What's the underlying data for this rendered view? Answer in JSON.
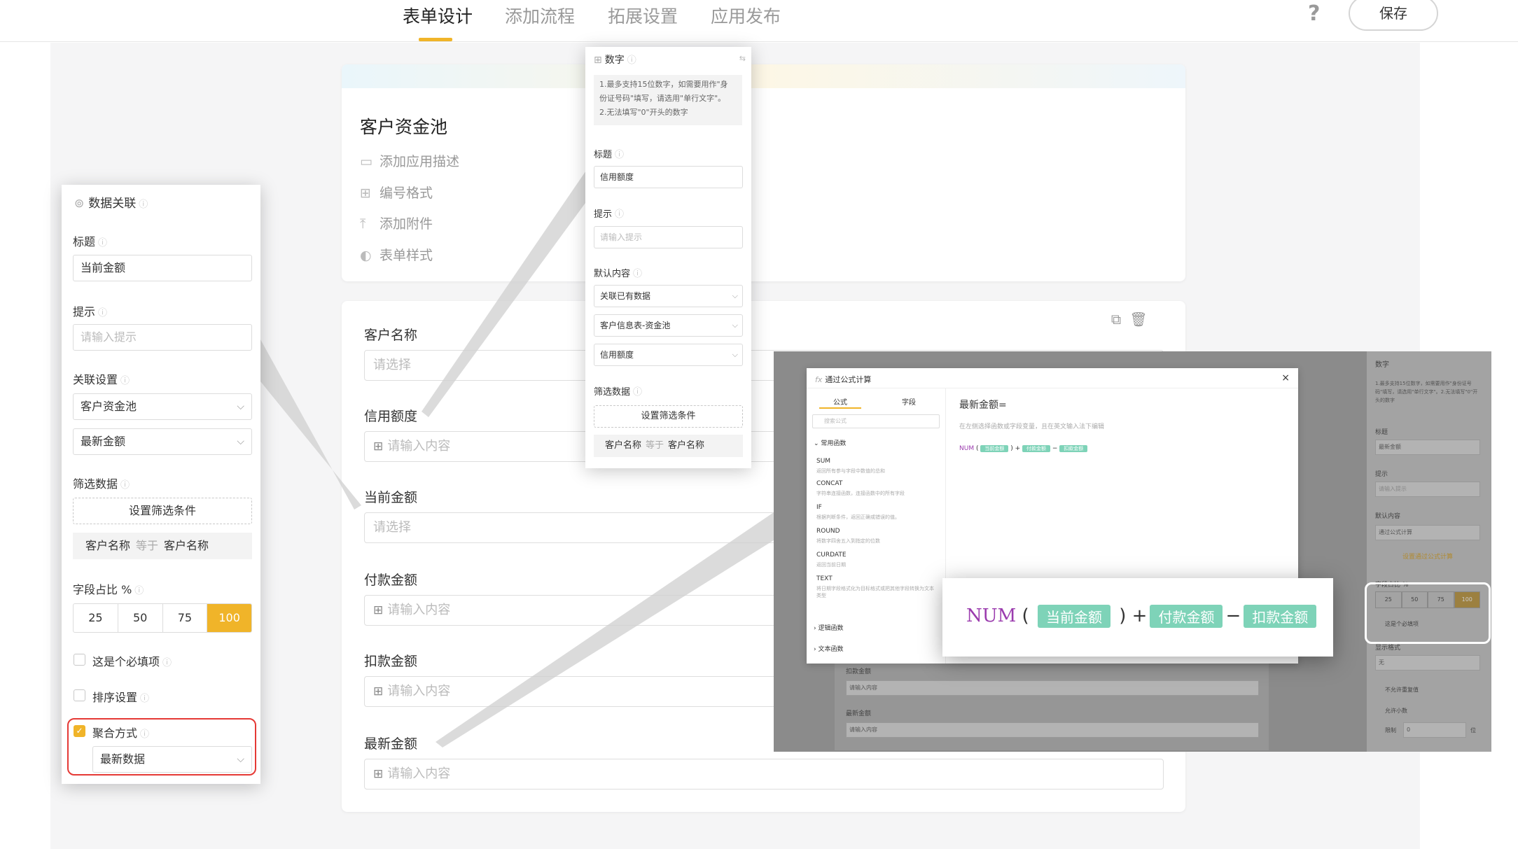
{
  "nav": {
    "tabs": [
      "表单设计",
      "添加流程",
      "拓展设置",
      "应用发布"
    ],
    "active_tab": "表单设计",
    "help": "?",
    "save": "保存"
  },
  "form": {
    "title": "客户资金池",
    "meta": [
      {
        "icon": "comment-icon",
        "label": "添加应用描述"
      },
      {
        "icon": "number-format-icon",
        "label": "编号格式"
      },
      {
        "icon": "upload-icon",
        "label": "添加附件"
      },
      {
        "icon": "palette-icon",
        "label": "表单样式"
      }
    ],
    "fields": [
      {
        "label": "客户名称",
        "placeholder": "请选择",
        "icon": ""
      },
      {
        "label": "信用额度",
        "placeholder": "请输入内容",
        "icon": "number-icon"
      },
      {
        "label": "当前金额",
        "placeholder": "请选择",
        "icon": ""
      },
      {
        "label": "付款金额",
        "placeholder": "请输入内容",
        "icon": "number-icon"
      },
      {
        "label": "扣款金额",
        "placeholder": "请输入内容",
        "icon": "number-icon"
      },
      {
        "label": "最新金额",
        "placeholder": "请输入内容",
        "icon": "number-icon"
      }
    ]
  },
  "left_panel": {
    "title": "数据关联",
    "title_label": "标题",
    "title_value": "当前金额",
    "hint_label": "提示",
    "hint_placeholder": "请输入提示",
    "link_label": "关联设置",
    "link_select1": "客户资金池",
    "link_select2": "最新金额",
    "filter_label": "筛选数据",
    "filter_button": "设置筛选条件",
    "filter_left": "客户名称",
    "filter_op": "等于",
    "filter_right": "客户名称",
    "width_label": "字段占比 %",
    "width_options": [
      "25",
      "50",
      "75",
      "100"
    ],
    "width_selected": "100",
    "required_label": "这是个必填项",
    "sort_label": "排序设置",
    "agg_label": "聚合方式",
    "agg_value": "最新数据"
  },
  "center_panel": {
    "title": "数字",
    "note_lines": [
      "1.最多支持15位数字，如需要用作\"身",
      "份证号码\"填写，请选用\"单行文字\"。",
      "2.无法填写\"0\"开头的数字"
    ],
    "title_label": "标题",
    "title_value": "信用额度",
    "hint_label": "提示",
    "hint_placeholder": "请输入提示",
    "default_label": "默认内容",
    "default_select1": "关联已有数据",
    "default_select2": "客户信息表-资金池",
    "default_select3": "信用额度",
    "filter_label": "筛选数据",
    "filter_button": "设置筛选条件",
    "filter_left": "客户名称",
    "filter_op": "等于",
    "filter_right": "客户名称"
  },
  "formula_modal": {
    "title": "通过公式计算",
    "tab_formula": "公式",
    "tab_field": "字段",
    "search_placeholder": "搜索公式",
    "group_common": "常用函数",
    "functions": [
      {
        "name": "SUM",
        "desc": "返回所有参与字段中数值的总和"
      },
      {
        "name": "CONCAT",
        "desc": "字符串连接函数，连接函数中的所有字段"
      },
      {
        "name": "IF",
        "desc": "根据判断条件，返回正确或错误的值。"
      },
      {
        "name": "ROUND",
        "desc": "将数字四舍五入到指定的位数"
      },
      {
        "name": "CURDATE",
        "desc": "返回当前日期"
      },
      {
        "name": "TEXT",
        "desc": "将日期字段格式化为目标格式或把其他字段转换为文本类型"
      }
    ],
    "group_logic": "逻辑函数",
    "group_text": "文本函数",
    "target": "最新金额=",
    "instruction": "在左侧选择函数或字段变量，且在英文输入法下编辑",
    "formula_fn": "NUM",
    "formula_parts": [
      "当前金额",
      "付款金额",
      "扣款金额"
    ],
    "formula_ops": [
      "+",
      "−"
    ]
  },
  "right_panel": {
    "title": "数字",
    "note": "1.最多支持15位数字，如需要用作\"身份证号码\"填写，请选用\"单行文字\"。2.无法填写\"0\"开头的数字",
    "title_label": "标题",
    "title_value": "最新金额",
    "hint_label": "提示",
    "hint_placeholder": "请输入提示",
    "default_label": "默认内容",
    "default_value": "通过公式计算",
    "formula_button": "设置通过公式计算",
    "width_label": "字段占比 %",
    "width_options": [
      "25",
      "50",
      "75",
      "100"
    ],
    "required_label": "这是个必填项",
    "display_label": "显示格式",
    "display_value": "无",
    "no_repeat_label": "不允许重复值",
    "decimal_label": "允许小数",
    "limit_label": "限制",
    "limit_value": "0",
    "limit_unit": "位"
  },
  "bg_fields": {
    "deduct_label": "扣款金额",
    "deduct_placeholder": "请输入内容",
    "latest_label": "最新金额",
    "latest_placeholder": "请输入内容"
  },
  "colors": {
    "accent": "#f0b429",
    "chip": "#7ed3b8",
    "highlight": "#e53935"
  }
}
